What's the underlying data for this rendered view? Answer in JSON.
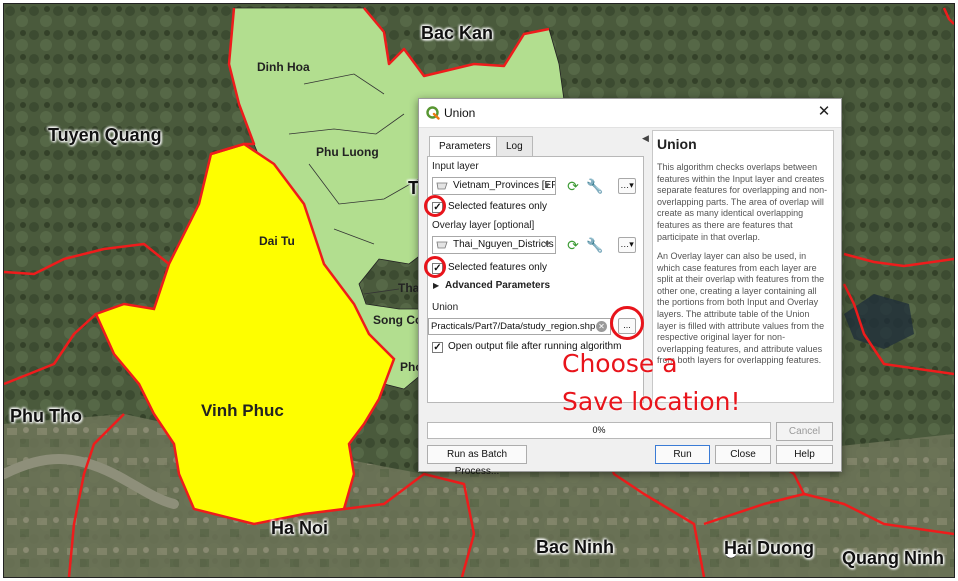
{
  "map": {
    "places": {
      "bac_kan": "Bac Kan",
      "dinh_hoa": "Dinh Hoa",
      "tuyen_quang": "Tuyen Quang",
      "phu_luong": "Phu Luong",
      "t_partial": "T",
      "dai_tu": "Dai Tu",
      "tha_partial": "Tha",
      "song_co_partial": "Song Co",
      "pho_partial": "Pho",
      "phu_tho": "Phu Tho",
      "vinh_phuc": "Vinh Phuc",
      "ha_noi": "Ha Noi",
      "bac_ninh": "Bac Ninh",
      "hai_duong": "Hai Duong",
      "quang_ninh": "Quang Ninh"
    },
    "colors": {
      "selected_province": "#fefe00",
      "districts": "#b2de8f",
      "boundary": "#ee1c1c",
      "imagery": "#4a5a3c"
    }
  },
  "dialog": {
    "title": "Union",
    "close_icon": "close-icon",
    "tabs": [
      {
        "label": "Parameters",
        "active": true
      },
      {
        "label": "Log",
        "active": false
      }
    ],
    "input_layer": {
      "label": "Input layer",
      "value": "Vietnam_Provinces [EP",
      "selected_only_label": "Selected features only",
      "selected_only_checked": true
    },
    "overlay_layer": {
      "label": "Overlay layer [optional]",
      "value": "Thai_Nguyen_Districts",
      "selected_only_label": "Selected features only",
      "selected_only_checked": true
    },
    "advanced_label": "Advanced Parameters",
    "output": {
      "label": "Union",
      "value": "Practicals/Part7/Data/study_region.shp",
      "browse_label": "...",
      "open_after_label": "Open output file after running algorithm",
      "open_after_checked": true
    },
    "help": {
      "title": "Union",
      "para1": "This algorithm checks overlaps between features within the Input layer and creates separate features for overlapping and non-overlapping parts. The area of overlap will create as many identical overlapping features as there are features that participate in that overlap.",
      "para2": "An Overlay layer can also be used, in which case features from each layer are split at their overlap with features from the other one, creating a layer containing all the portions from both Input and Overlay layers. The attribute table of the Union layer is filled with attribute values from the respective original layer for non-overlapping features, and attribute values from both layers for overlapping features."
    },
    "progress_label": "0%",
    "progress_value": 0,
    "buttons": {
      "cancel": "Cancel",
      "batch": "Run as Batch Process...",
      "run": "Run",
      "close": "Close",
      "help": "Help"
    }
  },
  "annotation": {
    "line1": "Choose a",
    "line2": "Save location!",
    "color": "#e8141b"
  }
}
